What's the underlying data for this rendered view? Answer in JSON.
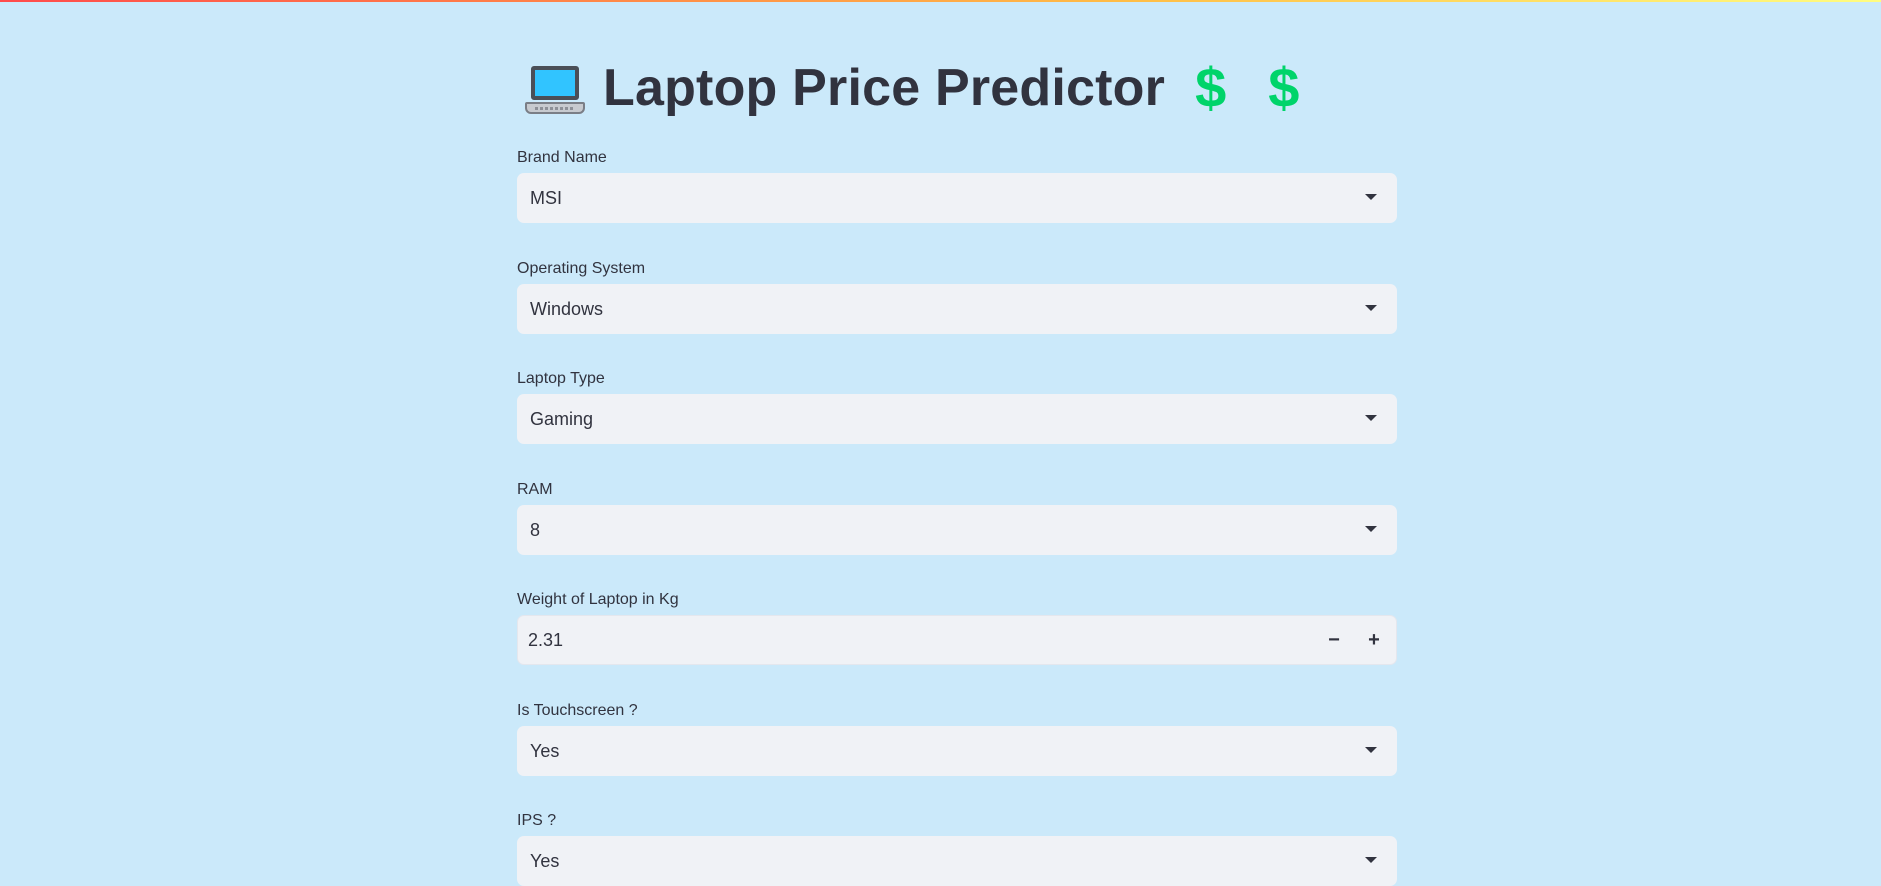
{
  "app": {
    "title": "Laptop Price Predictor",
    "title_prefix_icon": "laptop-emoji",
    "title_suffix_icons": [
      "dollar-sign-emoji",
      "dollar-sign-emoji"
    ],
    "dollar_glyph": "$",
    "colors": {
      "background": "#cbe9fa",
      "input_background": "#f0f2f6",
      "text": "#31333f",
      "dollar": "#00d46a"
    }
  },
  "form": {
    "brand": {
      "label": "Brand Name",
      "value": "MSI"
    },
    "os": {
      "label": "Operating System",
      "value": "Windows"
    },
    "type": {
      "label": "Laptop Type",
      "value": "Gaming"
    },
    "ram": {
      "label": "RAM",
      "value": "8"
    },
    "weight": {
      "label": "Weight of Laptop in Kg",
      "value": "2.31",
      "minus": "−",
      "plus": "+"
    },
    "touchscreen": {
      "label": "Is Touchscreen ?",
      "value": "Yes"
    },
    "ips": {
      "label": "IPS ?",
      "value": "Yes"
    }
  }
}
